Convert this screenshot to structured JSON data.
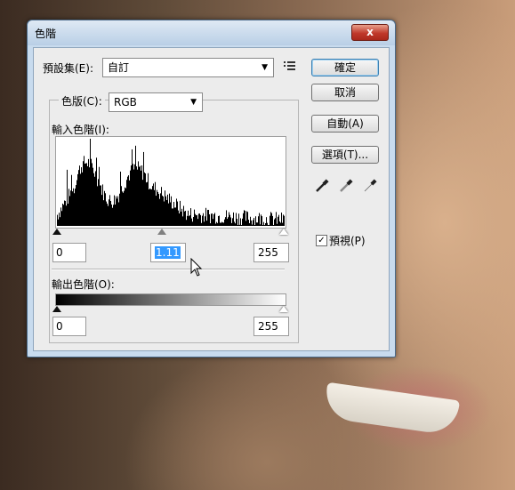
{
  "window": {
    "title": "色階",
    "close_label": "x"
  },
  "preset": {
    "label": "預設集(E):",
    "value": "自訂"
  },
  "channel": {
    "label": "色版(C):",
    "value": "RGB"
  },
  "input_levels": {
    "label": "輸入色階(I):",
    "black": "0",
    "gamma": "1.11",
    "white": "255"
  },
  "output_levels": {
    "label": "輸出色階(O):",
    "black": "0",
    "white": "255"
  },
  "buttons": {
    "ok": "確定",
    "cancel": "取消",
    "auto": "自動(A)",
    "options": "選項(T)..."
  },
  "preview": {
    "label": "預視(P)",
    "checked": true
  },
  "icons": [
    "preset-menu-icon",
    "black-eyedropper-icon",
    "gray-eyedropper-icon",
    "white-eyedropper-icon",
    "mouse-cursor-icon"
  ]
}
